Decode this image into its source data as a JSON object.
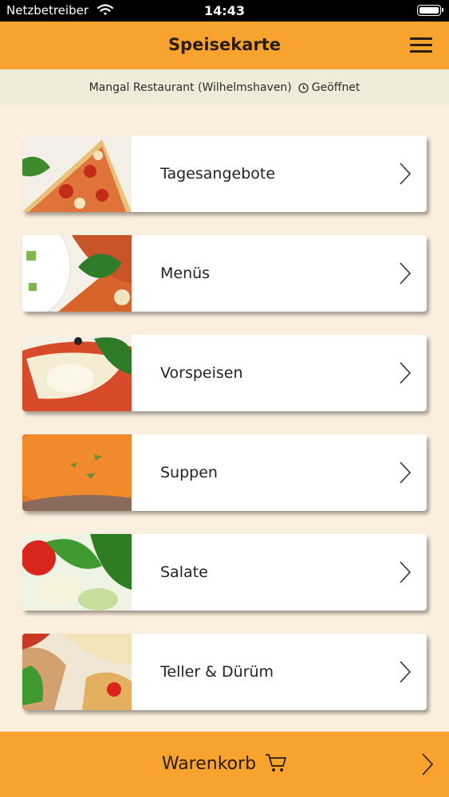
{
  "status_bar": {
    "carrier": "Netzbetreiber",
    "time": "14:43"
  },
  "header": {
    "title": "Speisekarte"
  },
  "info": {
    "restaurant": "Mangal Restaurant (Wilhelmshaven)",
    "status": "Geöffnet"
  },
  "menu": {
    "items": [
      {
        "label": "Tagesangebote"
      },
      {
        "label": "Menüs"
      },
      {
        "label": "Vorspeisen"
      },
      {
        "label": "Suppen"
      },
      {
        "label": "Salate"
      },
      {
        "label": "Teller & Dürüm"
      }
    ]
  },
  "cart": {
    "label": "Warenkorb"
  },
  "colors": {
    "accent": "#f7a32d",
    "background": "#faeedd",
    "info_bar": "#f0ead9"
  }
}
